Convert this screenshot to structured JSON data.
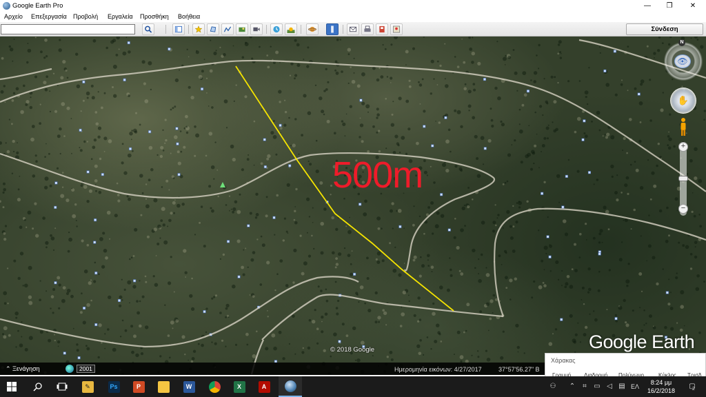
{
  "window": {
    "title": "Google Earth Pro",
    "controls": {
      "minimize": "—",
      "maximize": "❐",
      "close": "✕"
    }
  },
  "menu": [
    "Αρχείο",
    "Επεξεργασία",
    "Προβολή",
    "Εργαλεία",
    "Προσθήκη",
    "Βοήθεια"
  ],
  "toolbar": {
    "search_value": "",
    "buttons": [
      "search-icon",
      "sidebar-icon",
      "placemark-icon",
      "polygon-icon",
      "path-icon",
      "overlay-icon",
      "tour-icon",
      "history-icon",
      "sun-icon",
      "planets-icon",
      "ruler-icon",
      "email-icon",
      "print-icon",
      "save-image-icon",
      "maps-icon"
    ],
    "signin_label": "Σύνδεση"
  },
  "map": {
    "measure_label": "500m",
    "measure_line_color": "#f5e400",
    "measure_label_color": "#ee1c2a",
    "copyright": "© 2018 Google",
    "logo": "Google Earth",
    "compass_label": "N"
  },
  "statusbar": {
    "tour_label": "⌃ Ξενάγηση",
    "year": "2001",
    "image_date": "Ημερομηνία εικόνων: 4/27/2017",
    "coords": "37°57'56.27\" Β"
  },
  "ruler_panel": {
    "title": "Χάρακας",
    "tabs": [
      "Γραμμή",
      "Διαδρομή",
      "Πολύγωνο",
      "Κύκλος",
      "Τρισδ."
    ]
  },
  "taskbar": {
    "apps": [
      "start-icon",
      "search-icon",
      "task-view-icon",
      "app-icon",
      "photoshop-icon",
      "powerpoint-icon",
      "file-explorer-icon",
      "word-icon",
      "chrome-icon",
      "excel-icon",
      "acrobat-icon",
      "google-earth-icon"
    ],
    "tray": {
      "language": "ΕΛ",
      "time": "8:24 μμ",
      "date": "16/2/2018",
      "notifications": "2"
    }
  }
}
